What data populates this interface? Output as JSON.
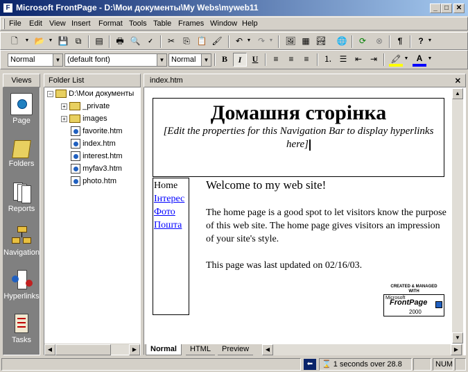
{
  "titlebar": {
    "title": "Microsoft FrontPage - D:\\Мои документы\\My Webs\\myweb11",
    "minimize": "_",
    "maximize": "□",
    "close": "✕"
  },
  "menu": [
    "File",
    "Edit",
    "View",
    "Insert",
    "Format",
    "Tools",
    "Table",
    "Frames",
    "Window",
    "Help"
  ],
  "formatting": {
    "style": "Normal",
    "font": "(default font)",
    "size": "Normal"
  },
  "views": {
    "header": "Views",
    "items": [
      "Page",
      "Folders",
      "Reports",
      "Navigation",
      "Hyperlinks",
      "Tasks"
    ]
  },
  "folders": {
    "header": "Folder List",
    "root": "D:\\Мои документы",
    "items": [
      "_private",
      "images",
      "favorite.htm",
      "index.htm",
      "interest.htm",
      "myfav3.htm",
      "photo.htm"
    ]
  },
  "editor": {
    "tab_title": "index.htm",
    "close": "✕",
    "page_heading": "Домашня сторінка",
    "nav_note": "[Edit the properties for this Navigation Bar to display hyperlinks here]",
    "nav_links": [
      "Home",
      "Інтерес",
      "Фото",
      "Пошта"
    ],
    "welcome": "Welcome to my web site!",
    "paragraph": "The home page is a good spot to let visitors know the purpose of this web site. The home page gives visitors an impression of your site's style.",
    "updated": "This page was last updated on 02/16/03.",
    "badge_top": "CREATED & MANAGED",
    "badge_with": "WITH",
    "badge_ms": "Microsoft",
    "badge_fp": "FrontPage",
    "badge_year": "2000",
    "tabs": [
      "Normal",
      "HTML",
      "Preview"
    ]
  },
  "status": {
    "speed": "1 seconds over 28.8",
    "num": "NUM"
  }
}
